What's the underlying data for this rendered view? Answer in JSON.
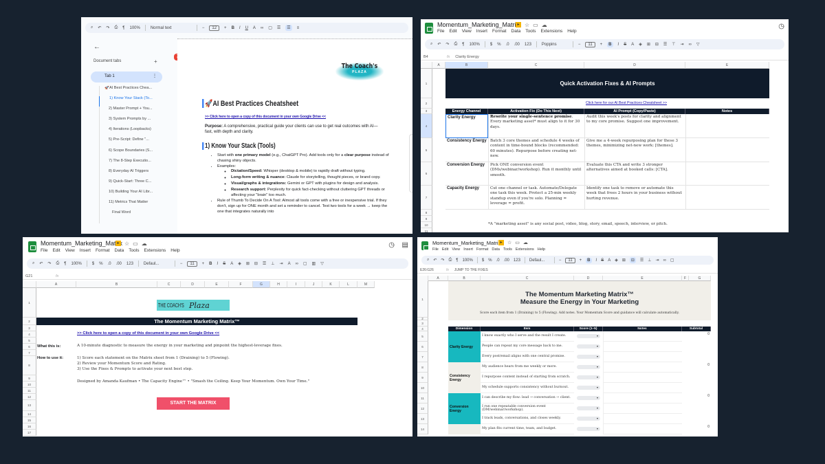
{
  "colors": {
    "background": "#17222f",
    "navy": "#0f1b2b",
    "teal": "#17b8bf",
    "cta": "#f0506a",
    "beige": "#f1efe9",
    "link": "#1a0dab"
  },
  "doc": {
    "toolbar": {
      "zoom": "100%",
      "style": "Normal text",
      "font_size": "12"
    },
    "sidebar": {
      "header": "Document tabs",
      "add": "+",
      "tab": "Tab 1",
      "items": [
        "🚀AI Best Practices Chea...",
        "1) Know Your Stack (To...",
        "2) Master Prompt + You...",
        "3) System Prompts by ...",
        "4) Iterations (Loopbacks)",
        "5) Pre-Script: Define \"...",
        "6) Scope Boundaries (S...",
        "7) The 8-Step Executio...",
        "8) Everyday AI Triggers",
        "9) Quick-Start: Three C...",
        "10) Building Your AI Libr...",
        "11) Metrics That Matter",
        "Final Word"
      ],
      "active_index": 1
    },
    "comment_badge": "7",
    "logo": {
      "line1": "The Coach's",
      "line2": "PLAZA"
    },
    "title": "🚀AI Best Practices Cheatsheet",
    "copy_link": ">> Click here to open a copy of this document in your own Google Drive <<",
    "purpose_label": "Purpose:",
    "purpose_text": " A comprehensive, practical guide your clients can use to get real outcomes with AI—fast, with depth and clarity.",
    "heading1": "1) Know Your Stack (Tools)",
    "bullet1": {
      "a": "Start with ",
      "b": "one primary model",
      "c": " (e.g., ChatGPT Pro). Add tools only for a ",
      "d": "clear purpose",
      "e": " instead of chasing shiny objects."
    },
    "bullet2": "Examples:",
    "examples": [
      {
        "label": "Dictation/Speed:",
        "text": " Whisper (desktop & mobile) to rapidly draft without typing."
      },
      {
        "label": "Long-form writing & nuance:",
        "text": " Claude for storytelling, thought pieces, or brand copy."
      },
      {
        "label": "Visual/graphs & integrations:",
        "text": " Gemini or GPT with plugins for design and analysis."
      },
      {
        "label": "Research support:",
        "text": " Perplexity for quick fact-checking without cluttering GPT threads or affecting your \"brain\" too much."
      }
    ],
    "bullet3": "Rule of Thumb To Decide On A Tool: Almost all tools come with a free or inexpensive trial. If they don't, sign up for ONE month and set a reminder to cancel. Test two tools for a week → keep the one that integrates naturally into"
  },
  "fixes": {
    "title": "Momentum_Marketing_Matrix",
    "menus": [
      "File",
      "Edit",
      "View",
      "Insert",
      "Format",
      "Data",
      "Tools",
      "Extensions",
      "Help"
    ],
    "toolbar": {
      "zoom": "100%",
      "font": "Poppins",
      "font_size": "11"
    },
    "cell_ref": "B4",
    "formula": "Clarity Energy",
    "columns": [
      "A",
      "B",
      "C",
      "D",
      "E"
    ],
    "rows": [
      "1",
      "2",
      "3",
      "4",
      "5",
      "6",
      "7",
      "8",
      "9",
      "10",
      "11"
    ],
    "banner": "Quick Activation Fixes & AI Prompts",
    "link": "Click here for our AI Best Practices Cheatsheet >>",
    "headers": [
      "Energy Channel",
      "Activation Fix (Do This Next)",
      "AI Prompt (Copy/Paste)",
      "Notes"
    ],
    "table": [
      {
        "channel": "Clarity Energy",
        "fix_bold": "Rewrite your single-sentence promise",
        "fix": ". Every marketing asset* must align to it for 30 days.",
        "prompt": "Audit this week's posts for clarity and alignment to my core promise. Suggest one improvement."
      },
      {
        "channel": "Consistency Energy",
        "fix_bold": "",
        "fix": "Batch 3 core themes and schedule 4 weeks of content in time-bound blocks (recommended: 60 minutes). Repurpose before creating net-new.",
        "prompt": "Give me a 4-week repurposing plan for these 3 themes, minimizing net-new work: [themes]."
      },
      {
        "channel": "Conversion Energy",
        "fix_bold": "",
        "fix": "Pick ONE conversion event (DMs/webinar/workshop). Run it monthly until smooth.",
        "prompt": "Evaluate this CTA and write 3 stronger alternatives aimed at booked calls: [CTA]."
      },
      {
        "channel": "Capacity Energy",
        "fix_bold": "",
        "fix": "Cut one channel or task. Automate/Delegate one task this week. Protect a 25-min weekly standup even if you're solo. Planning = leverage = profit.",
        "prompt": "Identify one task to remove or automate this week that frees 2 hours in your business without hurting revenue."
      }
    ],
    "footnote": "*A \"marketing asset\" is any social post, video, blog, story, email, speech, interview, or pitch."
  },
  "intro": {
    "title": "Momentum_Marketing_Matrix",
    "menus": [
      "File",
      "Edit",
      "View",
      "Insert",
      "Format",
      "Data",
      "Tools",
      "Extensions",
      "Help"
    ],
    "toolbar": {
      "zoom": "100%",
      "font": "Defaul...",
      "font_size": "11"
    },
    "cell_ref": "G21",
    "columns": [
      "A",
      "B",
      "C",
      "D",
      "E",
      "F",
      "G",
      "H",
      "I",
      "J",
      "K",
      "L",
      "M"
    ],
    "rows": [
      "1",
      "2",
      "3",
      "4",
      "5",
      "6",
      "7",
      "8",
      "9",
      "10",
      "11",
      "12",
      "13",
      "14",
      "15",
      "16",
      "17"
    ],
    "logo": {
      "line1": "THE COACH'S",
      "line2": "Plaza"
    },
    "banner": "The Momentum Marketing Matrix™",
    "link": ">> Click here to open a copy of this document in your own Google Drive <<",
    "what_label": "What this is:",
    "what_text": "A 10-minute diagnostic to measure the energy in your marketing and pinpoint the highest-leverage fixes.",
    "how_label": "How to use it:",
    "how_steps": [
      "1) Score each statement on the Matrix sheet from 1 (Draining) to 5 (Flowing).",
      "2) Review your Momentum Score and Rating.",
      "3) Use the Fixes & Prompts to activate your next best step."
    ],
    "credit": "Designed by Amanda Kaufman • The Capacity Engine™  • \"Smash the Ceiling. Keep Your Momentum. Own Your Time.\"",
    "cta": "START THE MATRIX"
  },
  "matrix": {
    "title": "Momentum_Marketing_Matrix",
    "menus": [
      "File",
      "Edit",
      "View",
      "Insert",
      "Format",
      "Data",
      "Tools",
      "Extensions",
      "Help"
    ],
    "toolbar": {
      "zoom": "100%",
      "font": "Defaul...",
      "font_size": "11"
    },
    "cell_ref": "E26:G26",
    "formula": "JUMP TO THE FIXES",
    "columns": [
      "A",
      "B",
      "C",
      "D",
      "E",
      "F",
      "G"
    ],
    "rows": [
      "1",
      "2",
      "3",
      "4",
      "5",
      "6",
      "7",
      "8",
      "9",
      "10",
      "11",
      "12",
      "13",
      "14"
    ],
    "title1": "The Momentum Marketing Matrix™",
    "title2": "Measure the Energy in Your Marketing",
    "subtitle": "Score each item from 1 (Draining) to 5 (Flowing). Add notes. Your Momentum Score and guidance will calculate automatically.",
    "headers": [
      "Dimension",
      "Item",
      "Score (1–5)",
      "Notes",
      "Subtotal"
    ],
    "groups": [
      {
        "dimension": "Clarity Energy",
        "teal": true,
        "subtotal": "0",
        "items": [
          "I know exactly who I serve and the result I create.",
          "People can repeat my core message back to me.",
          "Every post/email aligns with one central promise."
        ]
      },
      {
        "dimension": "Consistency Energy",
        "teal": false,
        "subtotal": "0",
        "items": [
          "My audience hears from me weekly or more.",
          "I repurpose content instead of starting from scratch.",
          "My schedule supports consistency without burnout."
        ]
      },
      {
        "dimension": "Conversion Energy",
        "teal": true,
        "subtotal": "0",
        "items": [
          "I can describe my flow: lead → conversation → client.",
          "I run one repeatable conversion event (DM/webinar/workshop).",
          "I track leads, conversations, and closes weekly."
        ]
      },
      {
        "dimension": "",
        "teal": false,
        "subtotal": "0",
        "items": [
          "My plan fits current time, team, and budget."
        ]
      }
    ]
  }
}
